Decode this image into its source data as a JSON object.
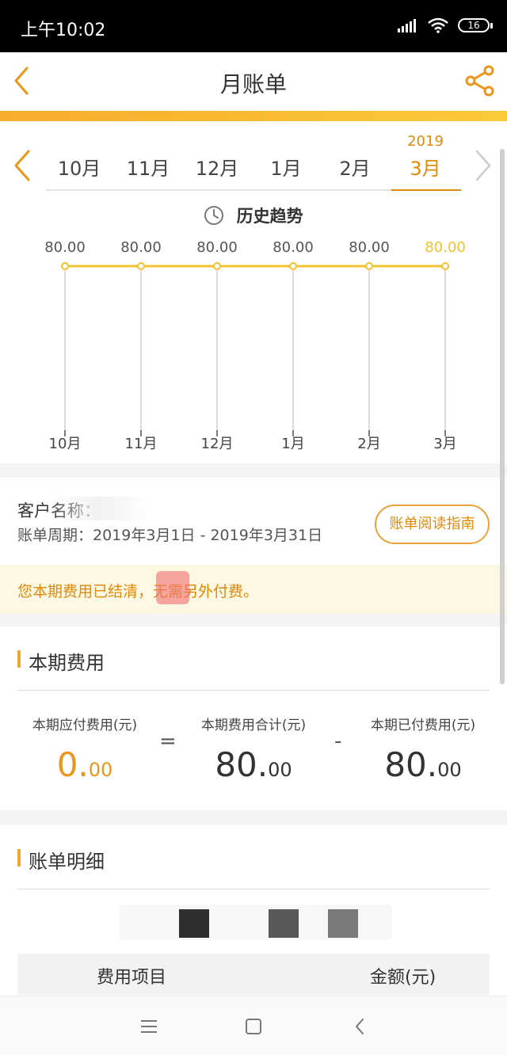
{
  "status_bar": {
    "time": "上午10:02",
    "battery": "16"
  },
  "nav": {
    "title": "月账单"
  },
  "months": {
    "tabs": [
      "10月",
      "11月",
      "12月",
      "1月",
      "2月",
      "3月"
    ],
    "year": "2019",
    "active_index": 5
  },
  "trend": {
    "title": "历史趋势"
  },
  "chart_data": {
    "type": "line",
    "categories": [
      "10月",
      "11月",
      "12月",
      "1月",
      "2月",
      "3月"
    ],
    "values": [
      80.0,
      80.0,
      80.0,
      80.0,
      80.0,
      80.0
    ],
    "value_labels": [
      "80.00",
      "80.00",
      "80.00",
      "80.00",
      "80.00",
      "80.00"
    ],
    "title": "历史趋势",
    "xlabel": "",
    "ylabel": "",
    "colors": {
      "line": "#f3c22c",
      "highlight_label": "#f3c22c",
      "drop_lines": "#d0d0d0"
    }
  },
  "info": {
    "customer_label": "客户名称：",
    "period": "账单周期：2019年3月1日 - 2019年3月31日",
    "guide_button": "账单阅读指南",
    "notice": "您本期费用已结清，无需另外付费。"
  },
  "fees": {
    "title": "本期费用",
    "payable_label": "本期应付费用(元)",
    "payable_int": "0.",
    "payable_dec": "00",
    "total_label": "本期费用合计(元)",
    "total_int": "80.",
    "total_dec": "00",
    "paid_label": "本期已付费用(元)",
    "paid_int": "80.",
    "paid_dec": "00",
    "equals": "=",
    "minus": "-"
  },
  "detail": {
    "title": "账单明细",
    "col_item": "费用项目",
    "col_amount": "金额(元)"
  },
  "colors": {
    "accent": "#e08a0b",
    "accent_light": "#f6ad2c"
  }
}
